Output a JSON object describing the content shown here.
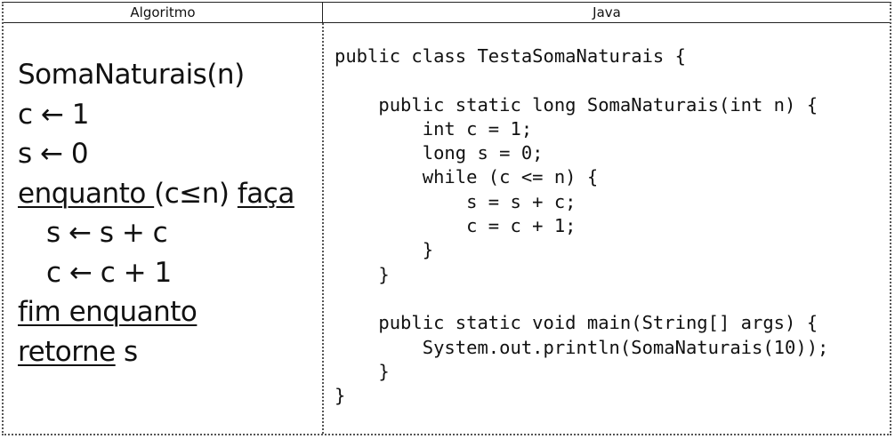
{
  "header": {
    "left_label": "Algoritmo",
    "right_label": "Java"
  },
  "algorithm": {
    "lines": [
      {
        "parts": [
          {
            "text": "SomaNaturais(n)",
            "kw": false
          }
        ]
      },
      {
        "parts": [
          {
            "text": "c ← 1",
            "kw": false
          }
        ]
      },
      {
        "parts": [
          {
            "text": "s ← 0",
            "kw": false
          }
        ]
      },
      {
        "parts": [
          {
            "text": "enquanto ",
            "kw": true
          },
          {
            "text": "(c≤n) ",
            "kw": false
          },
          {
            "text": "faça",
            "kw": true
          }
        ]
      },
      {
        "parts": [
          {
            "text": "s ← s + c",
            "kw": false
          }
        ],
        "indent": true
      },
      {
        "parts": [
          {
            "text": "c ← c + 1",
            "kw": false
          }
        ],
        "indent": true
      },
      {
        "parts": [
          {
            "text": "fim enquanto",
            "kw": true
          }
        ]
      },
      {
        "parts": [
          {
            "text": "retorne",
            "kw": true
          },
          {
            "text": " s",
            "kw": false
          }
        ]
      }
    ]
  },
  "java": {
    "lines": [
      "public class TestaSomaNaturais {",
      "",
      "    public static long SomaNaturais(int n) {",
      "        int c = 1;",
      "        long s = 0;",
      "        while (c <= n) {",
      "            s = s + c;",
      "            c = c + 1;",
      "        }",
      "    }",
      "",
      "    public static void main(String[] args) {",
      "        System.out.println(SomaNaturais(10));",
      "    }",
      "}"
    ]
  }
}
